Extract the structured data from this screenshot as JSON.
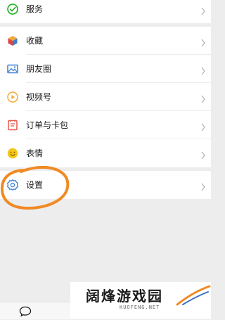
{
  "menu": {
    "service": {
      "label": "服务",
      "icon": "wechat-pay-icon"
    },
    "favorites": {
      "label": "收藏",
      "icon": "favorites-cube-icon"
    },
    "moments": {
      "label": "朋友圈",
      "icon": "moments-photo-icon"
    },
    "channels": {
      "label": "视频号",
      "icon": "channels-play-icon"
    },
    "orders": {
      "label": "订单与卡包",
      "icon": "orders-card-icon"
    },
    "stickers": {
      "label": "表情",
      "icon": "sticker-smiley-icon"
    },
    "settings": {
      "label": "设置",
      "icon": "settings-gear-icon"
    }
  },
  "bottom_nav": {
    "chat_icon": "chat-bubble-icon"
  },
  "watermark": {
    "title": "阔烽游戏园",
    "subtitle": "KUOFENG.NET"
  },
  "colors": {
    "background": "#ededed",
    "row": "#ffffff",
    "annotation": "#f08a24",
    "service_icon": "#1aad19",
    "favorites_icon": "#f2a93b",
    "moments_icon": "#3b7fd1",
    "channels_icon": "#f2a93b",
    "orders_icon": "#e8564b",
    "stickers_icon": "#f5c518",
    "settings_icon": "#3b7fd1"
  }
}
